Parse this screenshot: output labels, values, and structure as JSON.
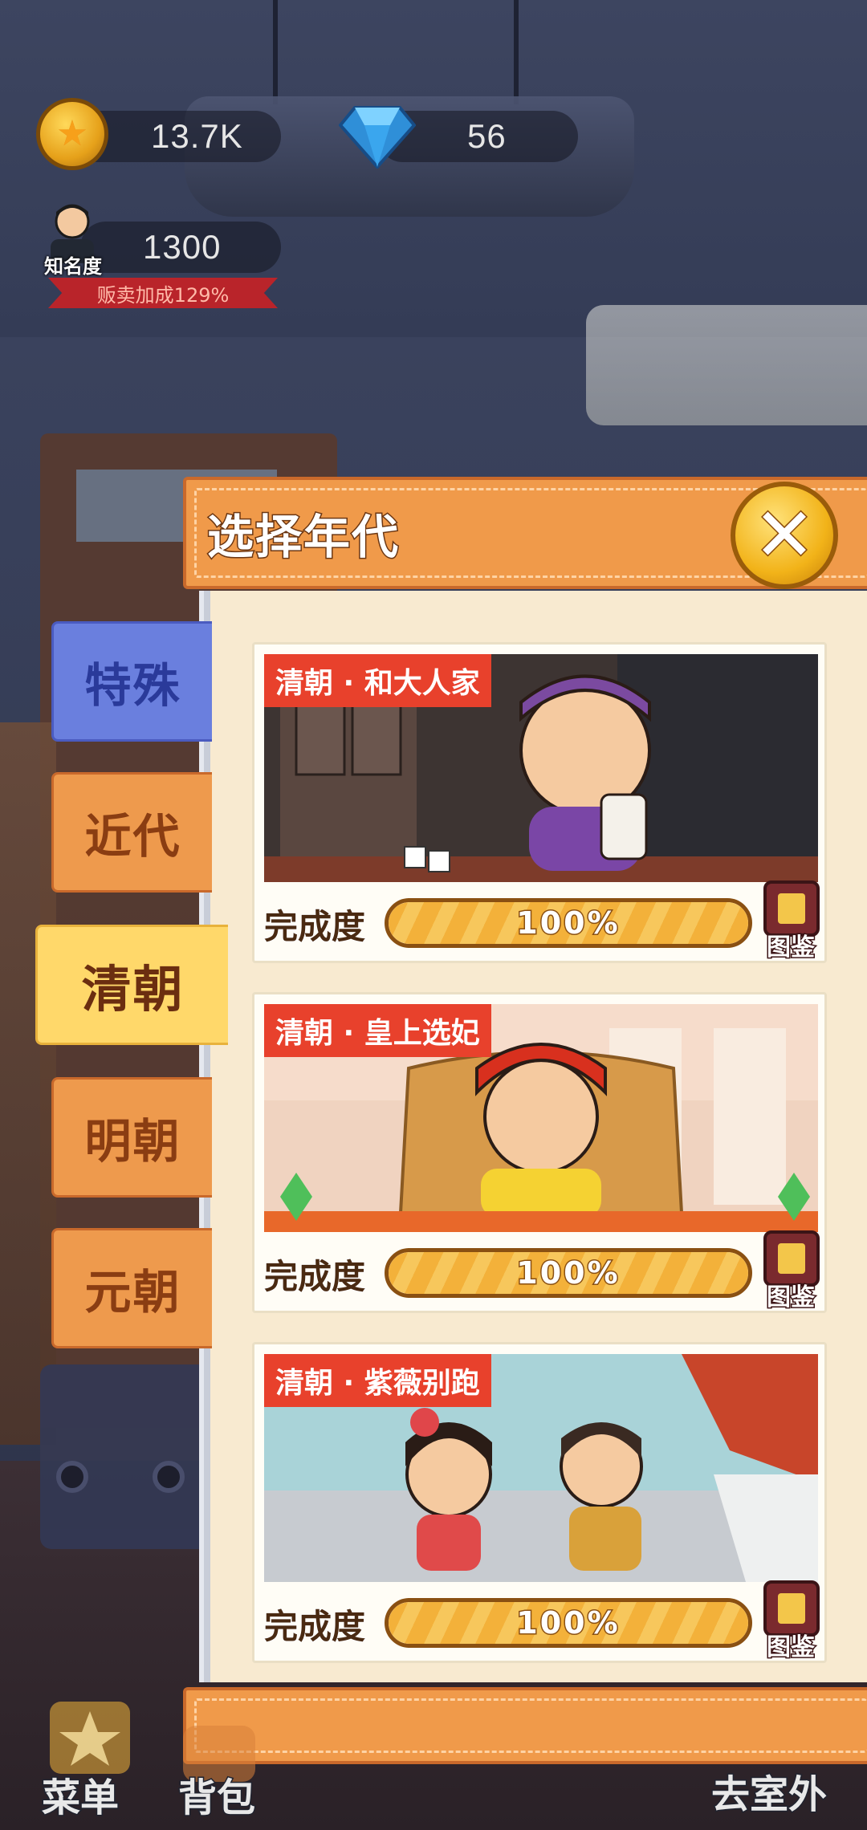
{
  "hud": {
    "coins": "13.7K",
    "gems": "56",
    "fame_value": "1300",
    "fame_label": "知名度",
    "sale_bonus": "贩卖加成129%"
  },
  "modal": {
    "title": "选择年代",
    "close_icon": "close-x-icon"
  },
  "eras": [
    {
      "label": "特殊",
      "style": "blue"
    },
    {
      "label": "近代",
      "style": "orange"
    },
    {
      "label": "清朝",
      "style": "selected"
    },
    {
      "label": "明朝",
      "style": "orange"
    },
    {
      "label": "元朝",
      "style": "orange"
    }
  ],
  "selected_era": "清朝",
  "scenes": [
    {
      "title": "清朝 · 和大人家",
      "progress_label": "完成度",
      "progress_value": 100,
      "progress_text": "100%",
      "album_label": "图鉴"
    },
    {
      "title": "清朝 · 皇上选妃",
      "progress_label": "完成度",
      "progress_value": 100,
      "progress_text": "100%",
      "album_label": "图鉴"
    },
    {
      "title": "清朝 · 紫薇别跑",
      "progress_label": "完成度",
      "progress_value": 100,
      "progress_text": "100%",
      "album_label": "图鉴"
    }
  ],
  "bottom": {
    "menu_label": "菜单",
    "bag_label": "背包",
    "outdoor_label": "去室外"
  },
  "colors": {
    "panel_orange": "#f09a4a",
    "panel_cream": "#f8ead0",
    "tab_blue": "#6a7fde",
    "tab_selected": "#ffd86a",
    "label_red": "#e8412c",
    "progress_gold": "#f3b13a"
  }
}
